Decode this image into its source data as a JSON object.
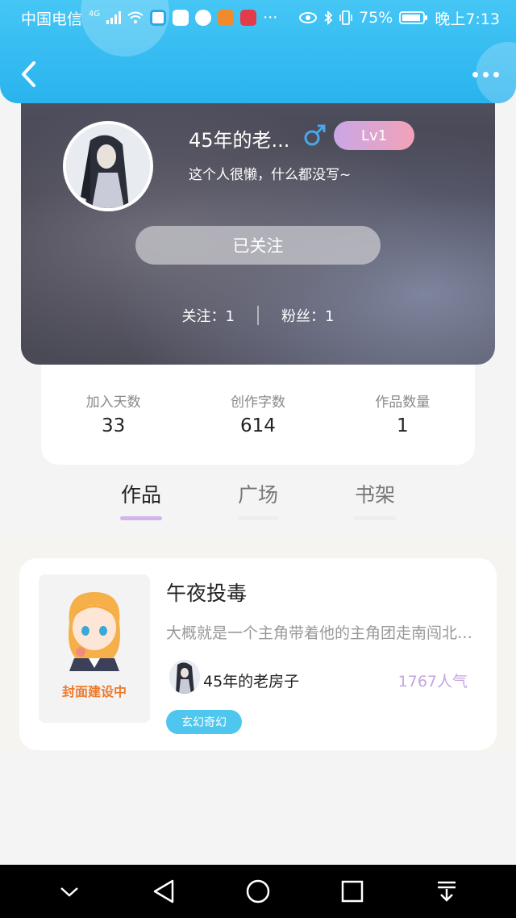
{
  "status_bar": {
    "carrier": "中国电信",
    "network": "4G",
    "battery_percent": "75%",
    "time": "晚上7:13",
    "more_dots": "···"
  },
  "profile": {
    "username": "45年的老...",
    "level": "Lv1",
    "bio": "这个人很懒，什么都没写~",
    "follow_button": "已关注",
    "following_label": "关注：",
    "following_count": "1",
    "fans_label": "粉丝：",
    "fans_count": "1"
  },
  "stats": [
    {
      "label": "加入天数",
      "value": "33"
    },
    {
      "label": "创作字数",
      "value": "614"
    },
    {
      "label": "作品数量",
      "value": "1"
    }
  ],
  "tabs": [
    {
      "label": "作品",
      "active": true
    },
    {
      "label": "广场",
      "active": false
    },
    {
      "label": "书架",
      "active": false
    }
  ],
  "work": {
    "cover_text": "封面建设中",
    "title": "午夜投毒",
    "description": "大概就是一个主角带着他的主角团走南闯北的故事",
    "author": "45年的老房子",
    "popularity": "1767人气",
    "tag": "玄幻奇幻"
  },
  "colors": {
    "header_blue": "#29b3ee",
    "accent_purple": "#c3a6e0",
    "tag_blue": "#4fc6ee",
    "male_blue": "#4aa8e8"
  },
  "icons": [
    "back-arrow-icon",
    "more-dots-icon",
    "male-icon",
    "nav-down-icon",
    "nav-back-icon",
    "nav-home-icon",
    "nav-recents-icon",
    "nav-menu-icon"
  ]
}
